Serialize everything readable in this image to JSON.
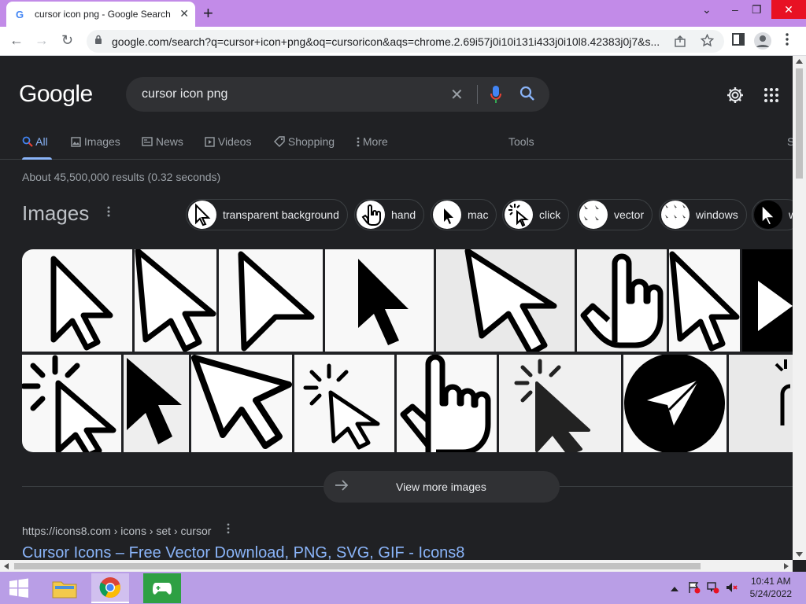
{
  "window": {
    "tab_title": "cursor icon png - Google Search",
    "tab_favicon": "G",
    "tab_close": "✕",
    "new_tab": "+",
    "controls": {
      "dropdown": "⌄",
      "minimize": "–",
      "restore": "❐",
      "close": "✕"
    }
  },
  "toolbar": {
    "back": "←",
    "forward": "→",
    "reload": "↻",
    "url": "google.com/search?q=cursor+icon+png&oq=cursoricon&aqs=chrome.2.69i57j0i10i131i433j0i10l8.42383j0j7&s..."
  },
  "search": {
    "logo": "Google",
    "query": "cursor icon png",
    "clear": "✕",
    "tabs": [
      {
        "label": "All",
        "active": true,
        "icon": "search-icon"
      },
      {
        "label": "Images",
        "icon": "image-icon"
      },
      {
        "label": "News",
        "icon": "news-icon"
      },
      {
        "label": "Videos",
        "icon": "video-icon"
      },
      {
        "label": "Shopping",
        "icon": "tag-icon"
      },
      {
        "label": "More",
        "icon": "more-vert-icon"
      }
    ],
    "tools": "Tools",
    "cut_tab": "S",
    "stats": "About 45,500,000 results (0.32 seconds)"
  },
  "images": {
    "header": "Images",
    "chips": [
      "transparent background",
      "hand",
      "mac",
      "click",
      "vector",
      "windows",
      "w"
    ],
    "view_more": "View more images"
  },
  "result": {
    "cite": "https://icons8.com › icons › set › cursor",
    "title": "Cursor Icons – Free Vector Download, PNG, SVG, GIF - Icons8"
  },
  "taskbar": {
    "time": "10:41 AM",
    "date": "5/24/2022"
  },
  "colors": {
    "page_bg": "#202124",
    "title_bar": "#c28be8",
    "link": "#8ab4f8",
    "taskbar": "#b99ee6"
  }
}
